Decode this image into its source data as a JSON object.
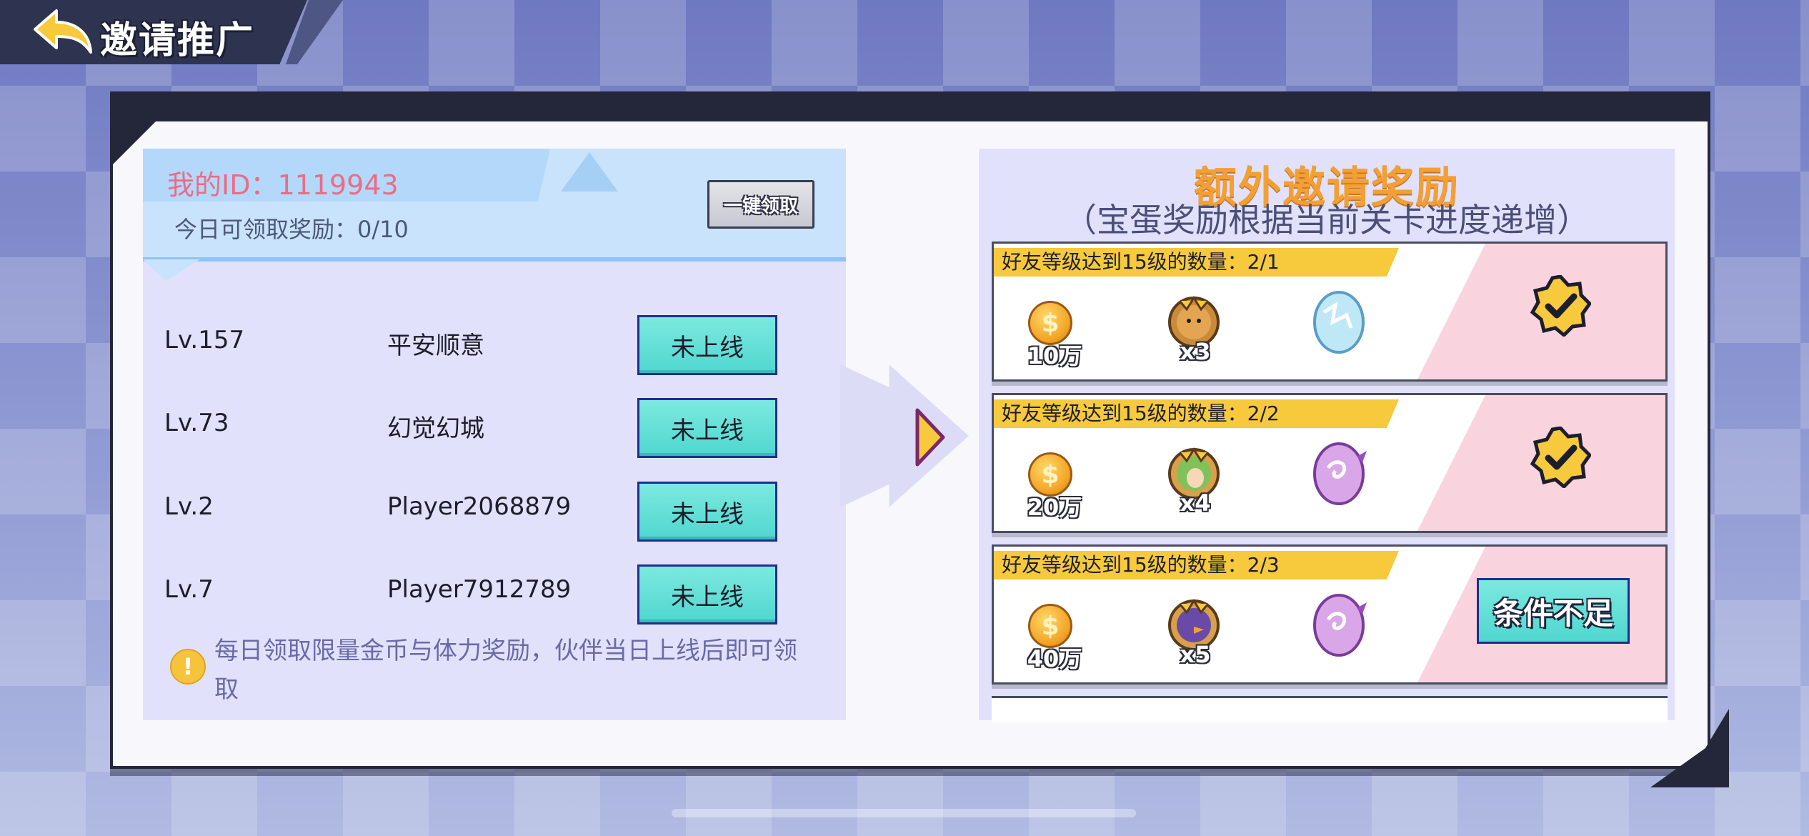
{
  "header": {
    "title": "邀请推广",
    "back_icon": "back-arrow-icon"
  },
  "left_panel": {
    "my_id": "我的ID：1119943",
    "today_claim": "今日可领取奖励：0/10",
    "claim_all_label": "一键领取",
    "friends": [
      {
        "level": "Lv.157",
        "name": "平安顺意",
        "status": "未上线"
      },
      {
        "level": "Lv.73",
        "name": "幻觉幻城",
        "status": "未上线"
      },
      {
        "level": "Lv.2",
        "name": "Player2068879",
        "status": "未上线"
      },
      {
        "level": "Lv.7",
        "name": "Player7912789",
        "status": "未上线"
      }
    ],
    "notice": "每日领取限量金币与体力奖励，伙伴当日上线后即可领取"
  },
  "right_panel": {
    "title": "额外邀请奖励",
    "subtitle": "（宝蛋奖励根据当前关卡进度递增）",
    "rewards": [
      {
        "condition": "好友等级达到15级的数量：2/1",
        "coins": "10万",
        "hero_count": "x3",
        "egg": "ice-egg-icon",
        "state": "claimed"
      },
      {
        "condition": "好友等级达到15级的数量：2/2",
        "coins": "20万",
        "hero_count": "x4",
        "egg": "purple-egg-icon",
        "state": "claimed"
      },
      {
        "condition": "好友等级达到15级的数量：2/3",
        "coins": "40万",
        "hero_count": "x5",
        "egg": "purple-egg-icon",
        "state": "locked",
        "button_label": "条件不足"
      }
    ]
  },
  "colors": {
    "id_text": "#ea6d87",
    "title_orange": "#f2a035",
    "button_teal": "#5fdcd3",
    "tag_yellow": "#f7c93c"
  }
}
